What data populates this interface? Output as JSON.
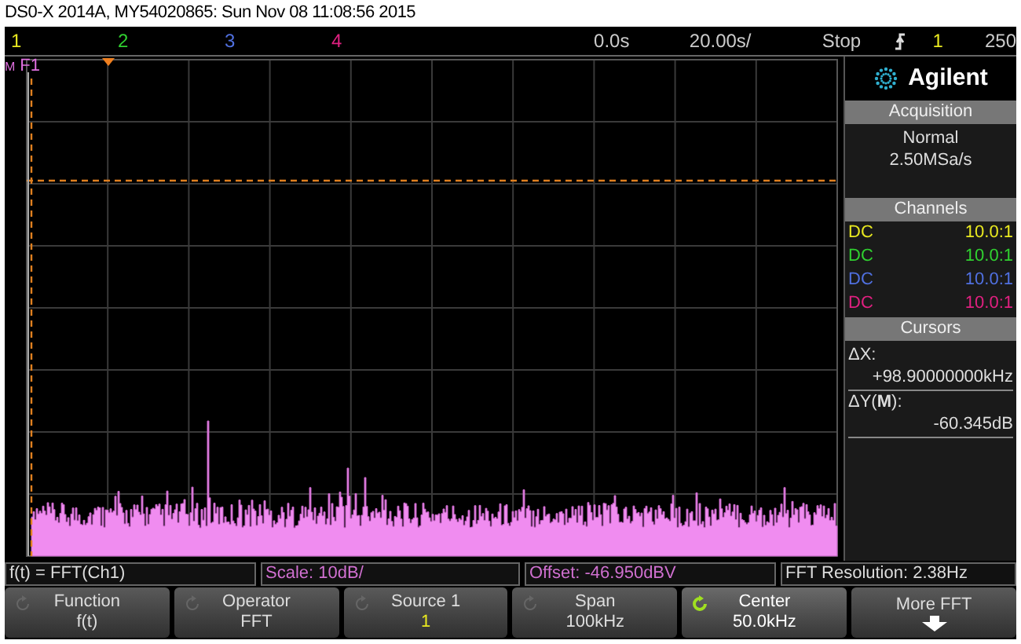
{
  "window": {
    "title": "DS0-X 2014A, MY54020865: Sun Nov 08 11:08:56 2015"
  },
  "status_bar": {
    "channels": [
      {
        "label": "1",
        "color": "#e8e820"
      },
      {
        "label": "2",
        "color": "#30d030"
      },
      {
        "label": "3",
        "color": "#5070e0"
      },
      {
        "label": "4",
        "color": "#e02080"
      }
    ],
    "delay": "0.0s",
    "timebase": "20.00s/",
    "run_state": "Stop",
    "trigger_source": "1",
    "trigger_level": "250"
  },
  "graticule": {
    "function_label": "F1",
    "marker": "M"
  },
  "panel": {
    "brand": "Agilent",
    "acquisition": {
      "title": "Acquisition",
      "mode": "Normal",
      "rate": "2.50MSa/s"
    },
    "channels": {
      "title": "Channels",
      "rows": [
        {
          "coupling": "DC",
          "probe": "10.0:1",
          "color": "#e8e820"
        },
        {
          "coupling": "DC",
          "probe": "10.0:1",
          "color": "#30d030"
        },
        {
          "coupling": "DC",
          "probe": "10.0:1",
          "color": "#5070e0"
        },
        {
          "coupling": "DC",
          "probe": "10.0:1",
          "color": "#e02080"
        }
      ]
    },
    "cursors": {
      "title": "Cursors",
      "dx_label": "ΔX:",
      "dx_value": "+98.90000000kHz",
      "dy_label": "ΔY(**M**):",
      "dy_value": "-60.345dB"
    }
  },
  "info_bar": [
    {
      "text": "f(t) = FFT(Ch1)",
      "kind": "plain"
    },
    {
      "text": "Scale: 10dB/",
      "kind": "math"
    },
    {
      "text": "Offset: -46.950dBV",
      "kind": "math"
    },
    {
      "text": "FFT Resolution: 2.38Hz",
      "kind": "plain"
    }
  ],
  "softkeys": [
    {
      "label": "Function",
      "value": "f(t)",
      "kind": "knob",
      "active": false
    },
    {
      "label": "Operator",
      "value": "FFT",
      "kind": "knob",
      "active": false
    },
    {
      "label": "Source 1",
      "value": "1",
      "kind": "source",
      "active": false
    },
    {
      "label": "Span",
      "value": "100kHz",
      "kind": "knob",
      "active": false
    },
    {
      "label": "Center",
      "value": "50.0kHz",
      "kind": "knob",
      "active": true
    },
    {
      "label": "More FFT",
      "kind": "menu",
      "active": false
    }
  ]
}
